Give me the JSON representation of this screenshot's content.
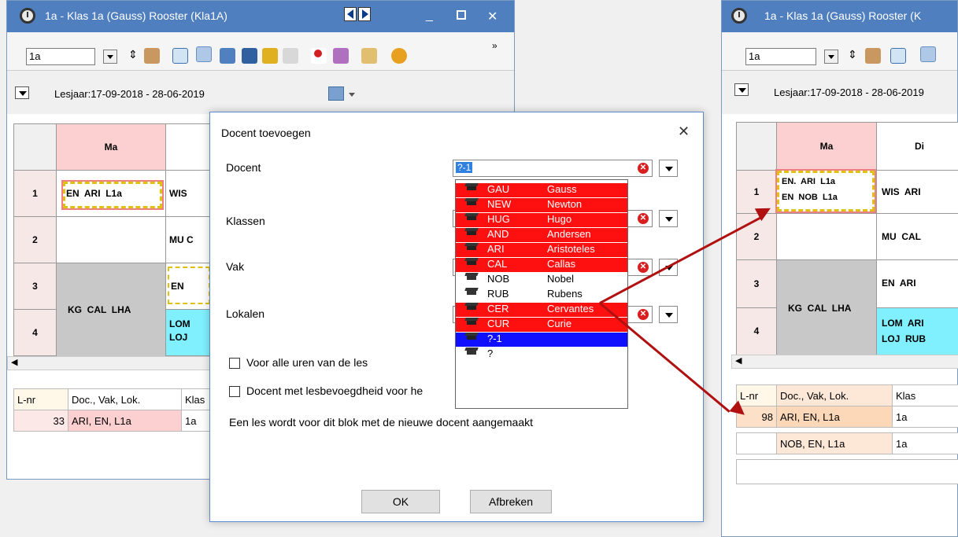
{
  "left_window": {
    "title": "1a - Klas 1a (Gauss)  Rooster  (Kla1A)",
    "class_combo": "1a",
    "period": "Lesjaar:17-09-2018 - 28-06-2019",
    "day_header": "Ma",
    "rows": [
      {
        "num": "1",
        "ma": "EN  ARI  L1a",
        "next": "WIS"
      },
      {
        "num": "2",
        "ma": "",
        "next": "MU  C"
      },
      {
        "num": "3",
        "ma": "",
        "next": "EN"
      },
      {
        "num": "4",
        "ma": "KG  CAL  LHA",
        "next": "LOM\nLOJ"
      }
    ],
    "bottom_headers": [
      "L-nr",
      "Doc., Vak, Lok.",
      "Klas"
    ],
    "bottom_rows": [
      {
        "lnr": "33",
        "doc": "ARI, EN, L1a",
        "klas": "1a"
      }
    ]
  },
  "right_window": {
    "title": "1a - Klas 1a (Gauss)  Rooster  (K",
    "class_combo": "1a",
    "period": "Lesjaar:17-09-2018 - 28-06-2019",
    "day_headers": [
      "Ma",
      "Di"
    ],
    "rows": [
      {
        "num": "1",
        "ma_line1": "EN.  ARI  L1a",
        "ma_line2": "EN  NOB  L1a",
        "next": "WIS  ARI"
      },
      {
        "num": "2",
        "ma": "",
        "next": "MU  CAL"
      },
      {
        "num": "3",
        "ma": "",
        "next": "EN  ARI"
      },
      {
        "num": "4",
        "ma": "KG  CAL  LHA",
        "next_line1": "LOM  ARI",
        "next_line2": "LOJ  RUB"
      }
    ],
    "bottom_headers": [
      "L-nr",
      "Doc., Vak, Lok.",
      "Klas"
    ],
    "bottom_rows": [
      {
        "lnr": "98",
        "doc": "ARI, EN, L1a",
        "klas": "1a"
      },
      {
        "lnr": "",
        "doc": "NOB, EN, L1a",
        "klas": "1a"
      }
    ]
  },
  "dialog": {
    "title": "Docent toevoegen",
    "close_glyph": "✕",
    "labels": {
      "docent": "Docent",
      "klassen": "Klassen",
      "vak": "Vak",
      "lokalen": "Lokalen"
    },
    "docent_value": "?-1",
    "checkbox1": "Voor alle uren van de les",
    "checkbox2": "Docent met lesbevoegdheid voor he",
    "note": "Een les wordt voor dit blok met de nieuwe docent aangemaakt",
    "ok": "OK",
    "cancel": "Afbreken"
  },
  "docent_list": [
    {
      "code": "GAU",
      "name": "Gauss",
      "style": "red"
    },
    {
      "code": "NEW",
      "name": "Newton",
      "style": "red"
    },
    {
      "code": "HUG",
      "name": "Hugo",
      "style": "red"
    },
    {
      "code": "AND",
      "name": "Andersen",
      "style": "red"
    },
    {
      "code": "ARI",
      "name": "Aristoteles",
      "style": "red"
    },
    {
      "code": "CAL",
      "name": "Callas",
      "style": "red"
    },
    {
      "code": "NOB",
      "name": "Nobel",
      "style": "plain"
    },
    {
      "code": "RUB",
      "name": "Rubens",
      "style": "plain"
    },
    {
      "code": "CER",
      "name": "Cervantes",
      "style": "red"
    },
    {
      "code": "CUR",
      "name": "Curie",
      "style": "red"
    },
    {
      "code": "?-1",
      "name": "",
      "style": "blue"
    },
    {
      "code": "?",
      "name": "",
      "style": "plain"
    }
  ],
  "colors": {
    "title_blue": "#4f7fbf",
    "list_red": "#ff1010",
    "list_blue": "#1010ff",
    "arrow": "#b01010",
    "day_pink": "#fcd0d0",
    "gray_cell": "#c8c8c8",
    "cyan_cell": "#80f0ff"
  }
}
